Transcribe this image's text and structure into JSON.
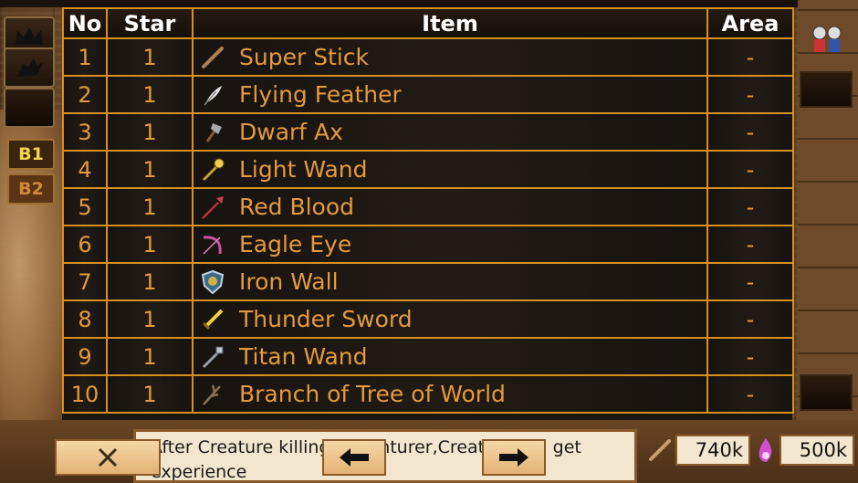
{
  "table": {
    "headers": {
      "no": "No",
      "star": "Star",
      "item": "Item",
      "area": "Area"
    },
    "rows": [
      {
        "no": "1",
        "star": "1",
        "item": "Super Stick",
        "area": "-",
        "icon": "stick-icon"
      },
      {
        "no": "2",
        "star": "1",
        "item": "Flying Feather",
        "area": "-",
        "icon": "feather-icon"
      },
      {
        "no": "3",
        "star": "1",
        "item": "Dwarf Ax",
        "area": "-",
        "icon": "axe-icon"
      },
      {
        "no": "4",
        "star": "1",
        "item": "Light Wand",
        "area": "-",
        "icon": "wand-icon"
      },
      {
        "no": "5",
        "star": "1",
        "item": "Red Blood",
        "area": "-",
        "icon": "spear-icon"
      },
      {
        "no": "6",
        "star": "1",
        "item": "Eagle Eye",
        "area": "-",
        "icon": "bow-icon"
      },
      {
        "no": "7",
        "star": "1",
        "item": "Iron Wall",
        "area": "-",
        "icon": "shield-icon"
      },
      {
        "no": "8",
        "star": "1",
        "item": "Thunder Sword",
        "area": "-",
        "icon": "sword-icon"
      },
      {
        "no": "9",
        "star": "1",
        "item": "Titan Wand",
        "area": "-",
        "icon": "staff-icon"
      },
      {
        "no": "10",
        "star": "1",
        "item": "Branch of Tree of World",
        "area": "-",
        "icon": "branch-icon"
      }
    ]
  },
  "sidebar": {
    "floors": [
      "B1",
      "B2"
    ]
  },
  "message": "After Creature killing Adventurer,Creature will get experience",
  "stats": {
    "gold": "740k",
    "mana": "500k"
  },
  "colors": {
    "accent": "#e49a3c",
    "border": "#d6901e",
    "header_text": "#ffffff"
  }
}
